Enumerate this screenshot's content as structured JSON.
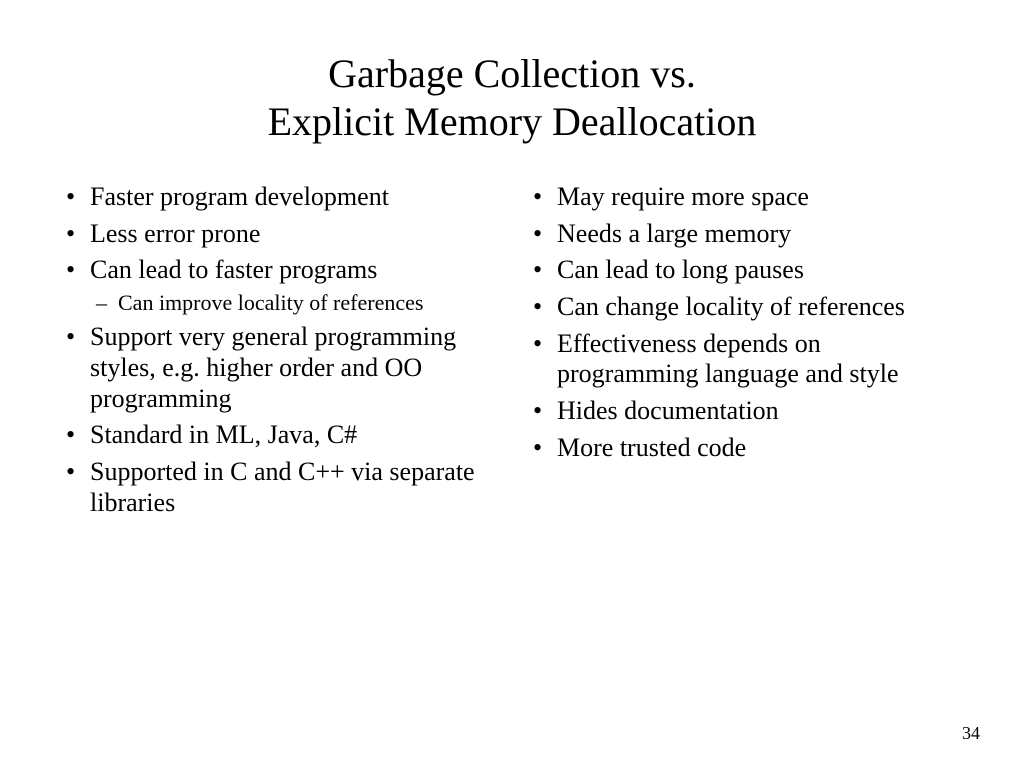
{
  "title_line1": "Garbage Collection vs.",
  "title_line2": "Explicit Memory Deallocation",
  "left": {
    "items": [
      {
        "text": "Faster program development"
      },
      {
        "text": "Less error prone"
      },
      {
        "text": "Can lead to faster programs",
        "sub": [
          "Can improve locality of references"
        ]
      },
      {
        "text": "Support very general programming styles, e.g. higher order and OO programming"
      },
      {
        "text": "Standard in ML, Java, C#"
      },
      {
        "text": "Supported in C and C++ via separate libraries"
      }
    ]
  },
  "right": {
    "items": [
      {
        "text": "May require more space"
      },
      {
        "text": "Needs a large memory"
      },
      {
        "text": "Can lead to long pauses"
      },
      {
        "text": "Can change locality of references"
      },
      {
        "text": "Effectiveness depends on programming language and style"
      },
      {
        "text": "Hides documentation"
      },
      {
        "text": "More trusted code"
      }
    ]
  },
  "page_number": "34"
}
